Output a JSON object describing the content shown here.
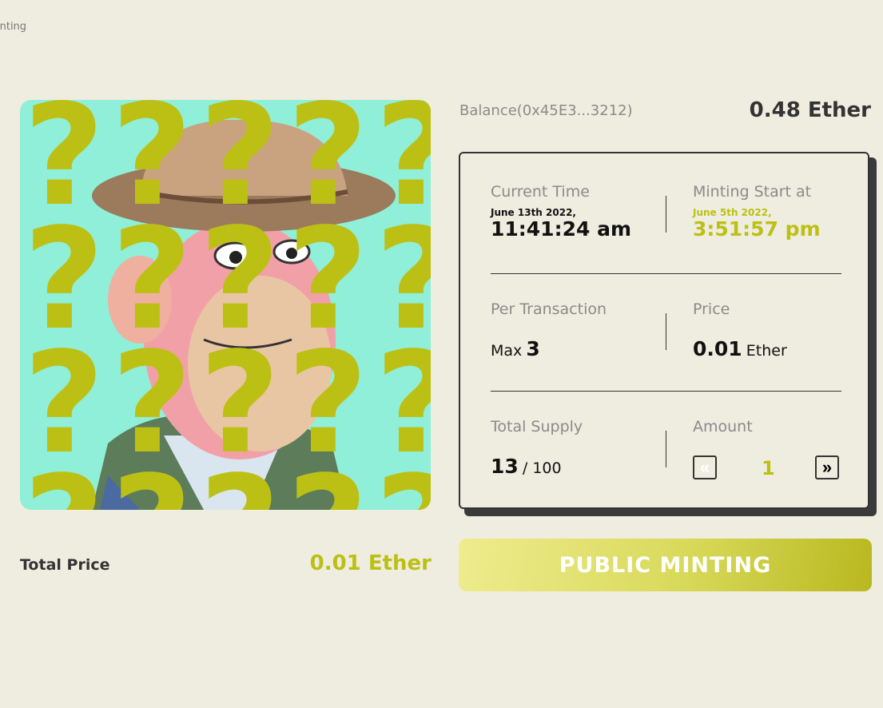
{
  "breadcrumb": "inting",
  "balance": {
    "label": "Balance(0x45E3...3212)",
    "value": "0.48 Ether"
  },
  "info": {
    "current_time": {
      "label": "Current Time",
      "date": "June 13th 2022,",
      "time": "11:41:24 am"
    },
    "minting_start": {
      "label": "Minting Start at",
      "date": "June 5th 2022,",
      "time": "3:51:57 pm"
    },
    "per_transaction": {
      "label": "Per Transaction",
      "prefix": "Max",
      "value": "3"
    },
    "price": {
      "label": "Price",
      "value": "0.01",
      "unit": "Ether"
    },
    "total_supply": {
      "label": "Total Supply",
      "minted": "13",
      "max": "/ 100"
    },
    "amount": {
      "label": "Amount",
      "value": "1",
      "decrement": "«",
      "increment": "»"
    }
  },
  "total_price": {
    "label": "Total Price",
    "value": "0.01 Ether"
  },
  "mint_button": "PUBLIC MINTING",
  "colors": {
    "accent": "#bcc015",
    "background": "#efede0",
    "art_background": "#8fefd8"
  }
}
